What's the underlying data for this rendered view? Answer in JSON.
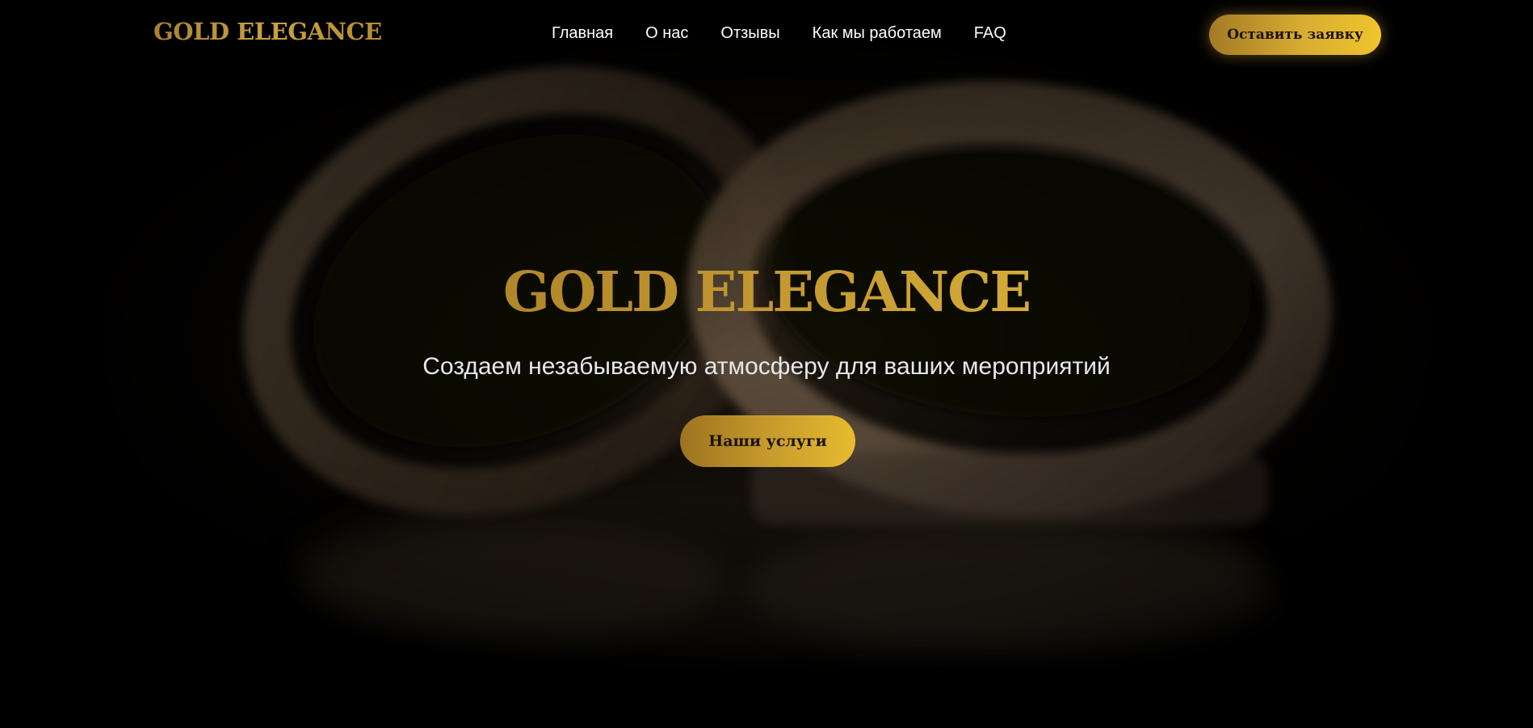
{
  "header": {
    "logo": "GOLD ELEGANCE",
    "nav": [
      {
        "label": "Главная"
      },
      {
        "label": "О нас"
      },
      {
        "label": "Отзывы"
      },
      {
        "label": "Как мы работаем"
      },
      {
        "label": "FAQ"
      }
    ],
    "cta_label": "Оставить заявку"
  },
  "hero": {
    "background_image": "two-wedding-rings-icon",
    "title": "GOLD ELEGANCE",
    "subtitle": "Создаем незабываемую атмосферу для ваших мероприятий",
    "cta_label": "Наши услуги"
  },
  "colors": {
    "background": "#000000",
    "gold_dark": "#a47a25",
    "gold_light": "#f0c42c",
    "text": "#ffffff",
    "button_text": "#1a1206"
  }
}
